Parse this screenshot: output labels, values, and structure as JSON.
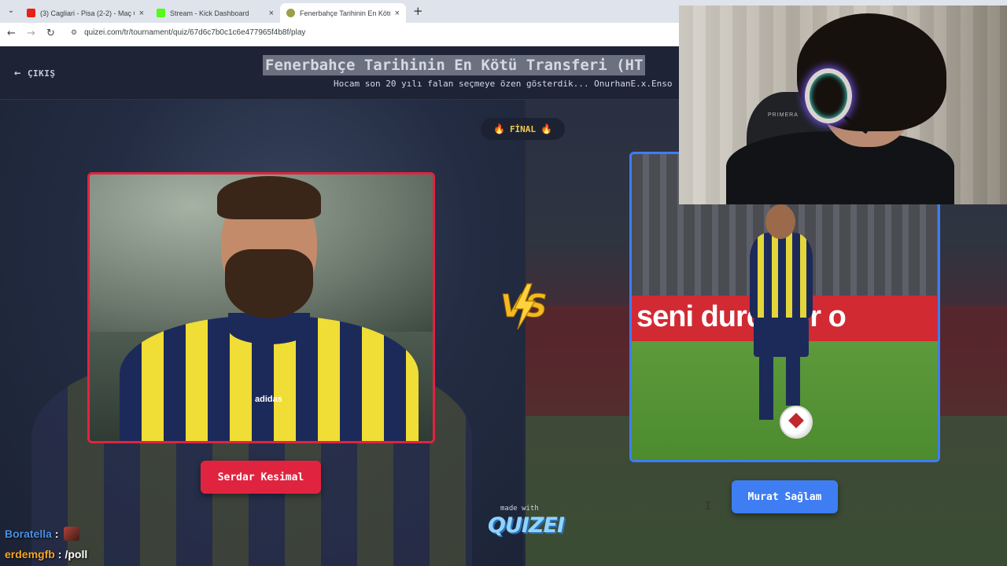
{
  "browser": {
    "tabs": [
      {
        "title": "(3) Cagliari - Pisa (2-2) - Maç Ö",
        "favicon_color": "#e62117"
      },
      {
        "title": "Stream - Kick Dashboard",
        "favicon_color": "#53fc18"
      },
      {
        "title": "Fenerbahçe Tarihinin En Kötü T",
        "favicon_color": "#9aa04a",
        "active": true
      }
    ],
    "new_tab_label": "+",
    "close_label": "×",
    "url": "quizei.com/tr/tournament/quiz/67d6c7b0c1c6e477965f4b8f/play"
  },
  "quiz": {
    "exit_label": "ÇIKIŞ",
    "title": "Fenerbahçe Tarihinin En Kötü Transferi (HT",
    "subtitle": "Hocam son 20 yılı falan seçmeye özen gösterdik... OnurhanE.x.Enso",
    "round_label": "FİNAL",
    "vs_label": "VS",
    "left_choice": {
      "name": "Serdar Kesimal",
      "color": "#e0243f",
      "jersey_brand": "adidas"
    },
    "right_choice": {
      "name": "Murat Sağlam",
      "color": "#3e7df2",
      "banner_text": "seni durdürür o"
    },
    "footer": {
      "made_with": "made with",
      "brand": "QUIZEI"
    }
  },
  "webcam": {
    "chair_label": "PRIMERA"
  },
  "chat": [
    {
      "user": "Boratella",
      "user_color": "#4a90e2",
      "separator": ":",
      "message": "",
      "has_emote": true
    },
    {
      "user": "erdemgfb",
      "user_color": "#f5a623",
      "separator": ":",
      "message": "/poll",
      "has_emote": false
    }
  ]
}
